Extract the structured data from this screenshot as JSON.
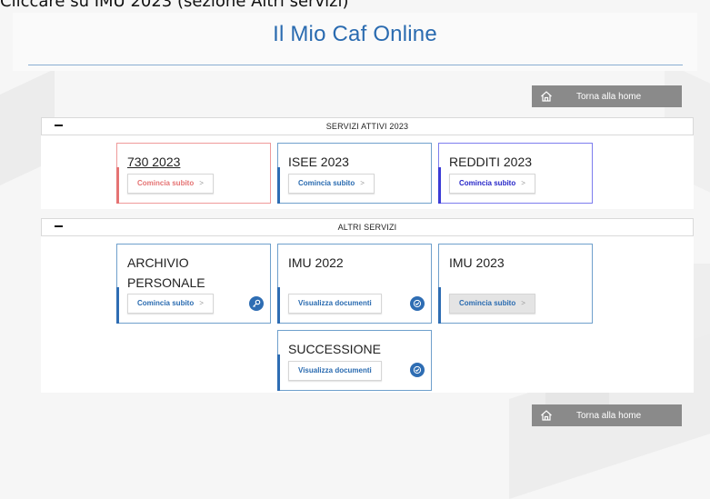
{
  "instruction": "Cliccare su IMU 2023 (sezione Altri servizi)",
  "app_title": "Il Mio Caf Online",
  "home_button": {
    "label": "Torna alla home",
    "icon": "home-icon"
  },
  "sections": [
    {
      "title": "SERVIZI ATTIVI 2023",
      "cards": [
        {
          "title": "730 2023",
          "button": "Comincia subito",
          "accent": "#e57373"
        },
        {
          "title": "ISEE 2023",
          "button": "Comincia subito",
          "accent": "#2e6db3"
        },
        {
          "title": "REDDITI 2023",
          "button": "Comincia subito",
          "accent": "#3b3bd6"
        }
      ]
    },
    {
      "title": "ALTRI SERVIZI",
      "cards": [
        {
          "title": "ARCHIVIO PERSONALE",
          "button": "Comincia subito",
          "icon": "key-icon"
        },
        {
          "title": "IMU 2022",
          "button": "Visualizza documenti",
          "icon": "check-circle-icon"
        },
        {
          "title": "IMU 2023",
          "button": "Comincia subito"
        },
        {
          "title": "SUCCESSIONE",
          "button": "Visualizza documenti",
          "icon": "check-circle-icon"
        }
      ]
    }
  ],
  "colors": {
    "brand": "#2a6bb0",
    "home_button_bg": "#8a8a8a",
    "card_accent": "#2e6db3"
  }
}
